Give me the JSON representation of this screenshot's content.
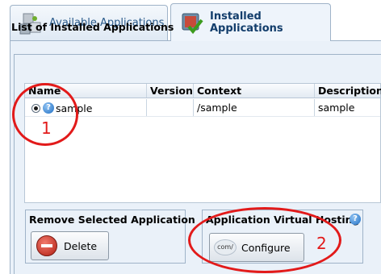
{
  "tabs": {
    "available_label": "Available Applications",
    "installed_label": "Installed Applications"
  },
  "list": {
    "title": "List of Installed Applications",
    "columns": [
      "Name",
      "Version",
      "Context",
      "Description"
    ],
    "rows": [
      {
        "selected": true,
        "name": "sample",
        "version": "",
        "context": "/sample",
        "description": "sample"
      }
    ]
  },
  "remove_box": {
    "title": "Remove Selected Application",
    "delete_label": "Delete"
  },
  "vhost_box": {
    "title": "Application Virtual Hosting",
    "help_glyph": "?",
    "configure_label": "Configure",
    "configure_icon_text": "com/"
  },
  "row_help_glyph": "?",
  "annotations": {
    "callout_1": "1",
    "callout_2": "2",
    "color": "#e21a1a"
  },
  "colors": {
    "panel_bg": "#eaf1f9",
    "border": "#9fb3c8",
    "accent_text": "#123d6b"
  }
}
